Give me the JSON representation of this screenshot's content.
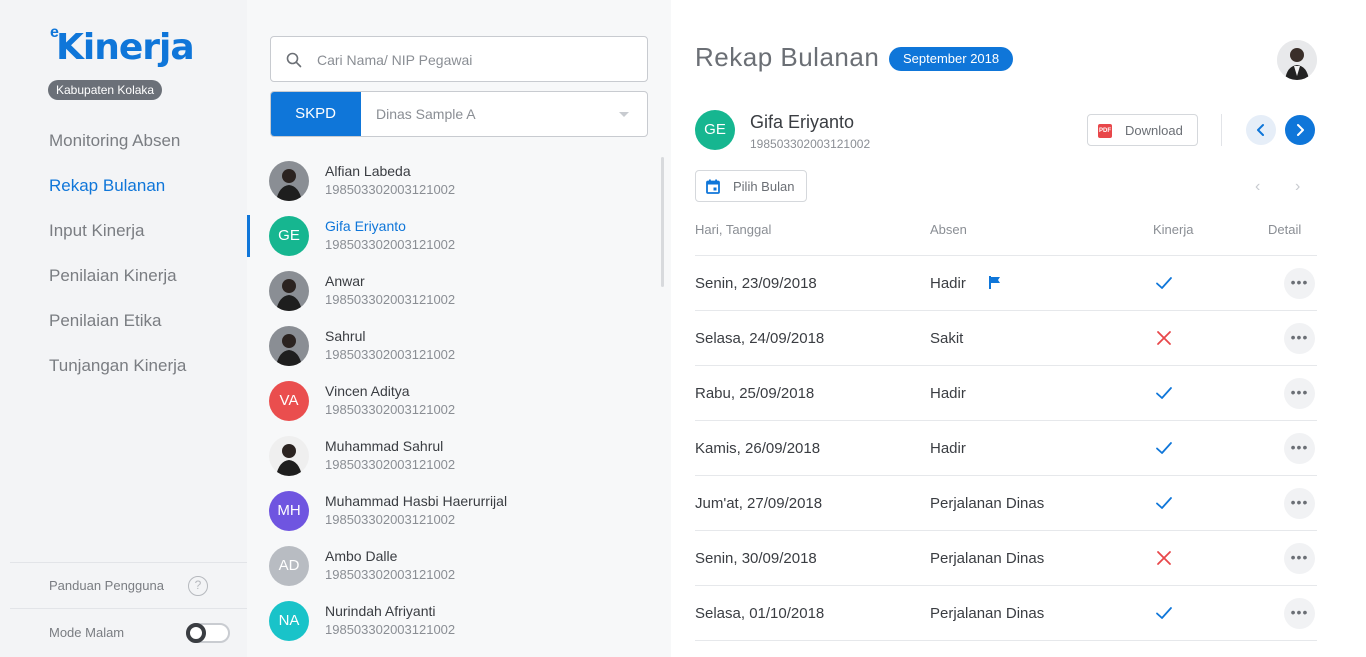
{
  "app": {
    "logo_text": "Kinerja",
    "logo_prefix": "e",
    "logo_badge": "Kabupaten Kolaka"
  },
  "sidebar": {
    "items": [
      {
        "label": "Monitoring Absen",
        "active": false
      },
      {
        "label": "Rekap Bulanan",
        "active": true
      },
      {
        "label": "Input Kinerja",
        "active": false
      },
      {
        "label": "Penilaian Kinerja",
        "active": false
      },
      {
        "label": "Penilaian Etika",
        "active": false
      },
      {
        "label": "Tunjangan Kinerja",
        "active": false
      }
    ],
    "guide_label": "Panduan Pengguna",
    "guide_icon": "help-circle-icon",
    "night_mode_label": "Mode Malam",
    "night_mode_on": false
  },
  "employee_panel": {
    "search": {
      "placeholder": "Cari Nama/ NIP Pegawai",
      "value": ""
    },
    "skpd_label": "SKPD",
    "skpd_value": "Dinas Sample A",
    "employees": [
      {
        "name": "Alfian Labeda",
        "nip": "198503302003121002",
        "initials": "",
        "photo": true,
        "color": "#3a3d42"
      },
      {
        "name": "Gifa Eriyanto",
        "nip": "198503302003121002",
        "initials": "GE",
        "photo": false,
        "color": "#16b690",
        "active": true
      },
      {
        "name": "Anwar",
        "nip": "198503302003121002",
        "initials": "",
        "photo": true,
        "color": "#4a4d52"
      },
      {
        "name": "Sahrul",
        "nip": "198503302003121002",
        "initials": "",
        "photo": true,
        "color": "#5a7d8c"
      },
      {
        "name": "Vincen Aditya",
        "nip": "198503302003121002",
        "initials": "VA",
        "photo": false,
        "color": "#ea4e4e"
      },
      {
        "name": "Muhammad Sahrul",
        "nip": "198503302003121002",
        "initials": "",
        "photo": true,
        "color": "#e9e9e9"
      },
      {
        "name": "Muhammad Hasbi Haerurrijal",
        "nip": "198503302003121002",
        "initials": "MH",
        "photo": false,
        "color": "#6f55e0"
      },
      {
        "name": "Ambo Dalle",
        "nip": "198503302003121002",
        "initials": "AD",
        "photo": false,
        "color": "#b8bcc2"
      },
      {
        "name": "Nurindah Afriyanti",
        "nip": "198503302003121002",
        "initials": "NA",
        "photo": false,
        "color": "#19c3c9"
      }
    ]
  },
  "main": {
    "title": "Rekap Bulanan",
    "month": "September 2018",
    "person": {
      "initials": "GE",
      "name": "Gifa Eriyanto",
      "nip": "198503302003121002"
    },
    "download_label": "Download",
    "pick_month_label": "Pilih Bulan",
    "columns": {
      "date": "Hari, Tanggal",
      "absen": "Absen",
      "kinerja": "Kinerja",
      "detail": "Detail"
    },
    "rows": [
      {
        "date": "Senin, 23/09/2018",
        "absen": "Hadir",
        "flag": true,
        "kinerja": "ok"
      },
      {
        "date": "Selasa, 24/09/2018",
        "absen": "Sakit",
        "flag": false,
        "kinerja": "fail"
      },
      {
        "date": "Rabu, 25/09/2018",
        "absen": "Hadir",
        "flag": false,
        "kinerja": "ok"
      },
      {
        "date": "Kamis, 26/09/2018",
        "absen": "Hadir",
        "flag": false,
        "kinerja": "ok"
      },
      {
        "date": "Jum'at, 27/09/2018",
        "absen": "Perjalanan Dinas",
        "flag": false,
        "kinerja": "ok"
      },
      {
        "date": "Senin, 30/09/2018",
        "absen": "Perjalanan Dinas",
        "flag": false,
        "kinerja": "fail"
      },
      {
        "date": "Selasa, 01/10/2018",
        "absen": "Perjalanan Dinas",
        "flag": false,
        "kinerja": "ok"
      }
    ],
    "more_glyph": "•••"
  },
  "colors": {
    "accent": "#0f76d9",
    "ok": "#0f76d9",
    "fail": "#e8474a",
    "muted": "#8a8e94"
  }
}
